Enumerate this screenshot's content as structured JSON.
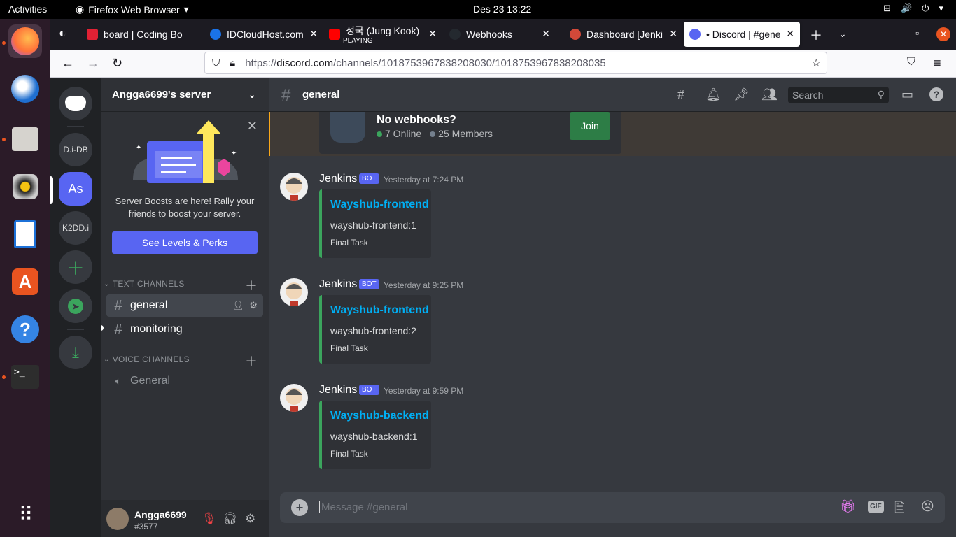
{
  "topbar": {
    "activities": "Activities",
    "app_menu": "Firefox Web Browser",
    "clock": "Des 23  13:22"
  },
  "browser": {
    "tabs": [
      {
        "label": "board | Coding Bo",
        "favicon": "#e22134"
      },
      {
        "label": "IDCloudHost.com",
        "favicon": "#1a73e8"
      },
      {
        "label": "정국 (Jung Kook) ",
        "sub": "PLAYING",
        "favicon": "#ff0000"
      },
      {
        "label": "Webhooks",
        "favicon": "#24292f"
      },
      {
        "label": "Dashboard [Jenki",
        "favicon": "#d24939"
      },
      {
        "label": "• Discord | #gene",
        "favicon": "#5865f2"
      }
    ],
    "url_prefix": "https://",
    "url_host": "discord.com",
    "url_path": "/channels/1018753967838208030/1018753967838208035"
  },
  "discord": {
    "guilds": [
      {
        "label": "D.i-DB"
      },
      {
        "label": "As"
      },
      {
        "label": "K2DD.i"
      }
    ],
    "server_name": "Angga6699's server",
    "boost": {
      "text": "Server Boosts are here! Rally your friends to boost your server.",
      "button": "See Levels & Perks"
    },
    "text_category": "TEXT CHANNELS",
    "voice_category": "VOICE CHANNELS",
    "text_channels": [
      "general",
      "monitoring"
    ],
    "voice_channels": [
      "General"
    ],
    "user": {
      "name": "Angga6699",
      "tag": "#3577"
    },
    "channel_title": "general",
    "search_placeholder": "Search",
    "invite": {
      "name": "No webhooks?",
      "online": "7 Online",
      "members": "25 Members",
      "join": "Join"
    },
    "messages": [
      {
        "author": "Jenkins",
        "badge": "BOT",
        "time": "Yesterday at 7:24 PM",
        "embed_title": "Wayshub-frontend",
        "embed_desc": "wayshub-frontend:1",
        "embed_footer": "Final Task"
      },
      {
        "author": "Jenkins",
        "badge": "BOT",
        "time": "Yesterday at 9:25 PM",
        "embed_title": "Wayshub-frontend",
        "embed_desc": "wayshub-frontend:2",
        "embed_footer": "Final Task"
      },
      {
        "author": "Jenkins",
        "badge": "BOT",
        "time": "Yesterday at 9:59 PM",
        "embed_title": "Wayshub-backend",
        "embed_desc": "wayshub-backend:1",
        "embed_footer": "Final Task"
      }
    ],
    "composer_placeholder": "Message #general",
    "gif_label": "GIF"
  },
  "colors": {
    "blurple": "#5865f2",
    "green": "#3ba55d",
    "link": "#00aff4",
    "ubuntu_orange": "#e95420"
  }
}
